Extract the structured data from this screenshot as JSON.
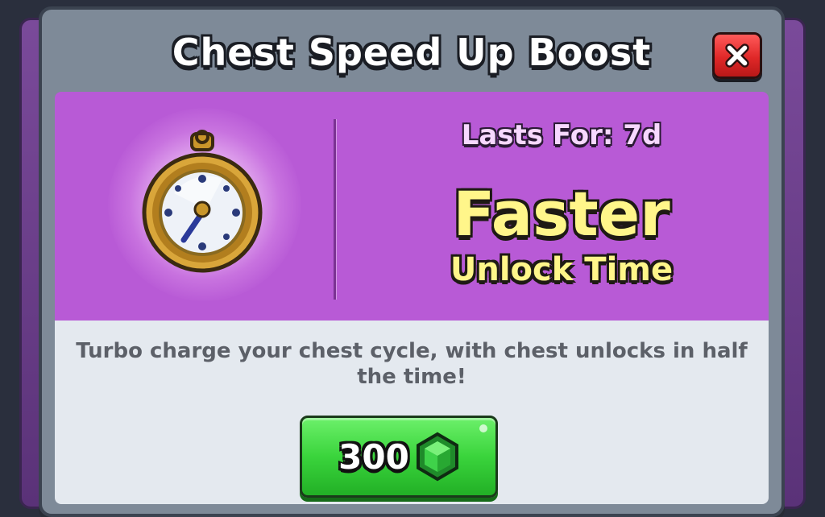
{
  "dialog": {
    "title": "Chest Speed Up Boost",
    "close_icon": "close-x-icon"
  },
  "hero": {
    "item_icon": "stopwatch-icon",
    "lasts_for": "Lasts For: 7d",
    "headline": "Faster",
    "subheadline": "Unlock Time"
  },
  "description": "Turbo charge your chest cycle, with chest unlocks in half the time!",
  "purchase": {
    "price": "300",
    "currency_icon": "gem-icon"
  },
  "colors": {
    "hero_bg": "#b85ad6",
    "headline": "#fff68a",
    "button_green": "#3ad43c",
    "close_red": "#e02828"
  }
}
